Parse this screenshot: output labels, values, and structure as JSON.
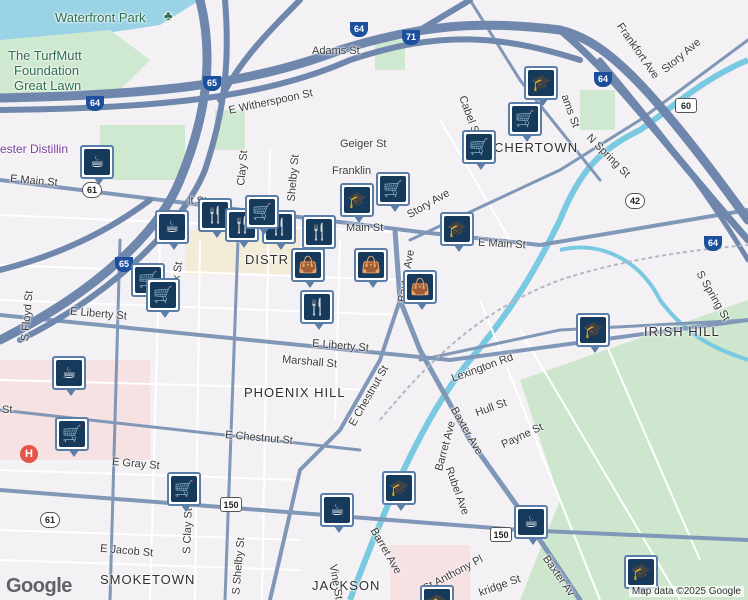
{
  "streets": {
    "e_main_w": "E Main St",
    "e_main_e": "E Main St",
    "main_st_mid": "Main St",
    "e_liberty_w": "E Liberty St",
    "e_liberty_e": "E Liberty St",
    "marshall": "Marshall St",
    "e_chestnut_w": "E Chestnut St",
    "e_chestnut_diag": "E Chestnut St",
    "e_gray": "E Gray St",
    "e_jacob": "E Jacob St",
    "s_clay": "S Clay St",
    "s_shelby": "S Shelby St",
    "s_floyd": "S Floyd St",
    "baxter_ave_n": "Baxter Ave",
    "baxter_ave_s": "Baxter Ave",
    "baxter_ave_se": "Baxter Av",
    "barret_ave": "Barret Ave",
    "barret_ave_s": "Barret Ave",
    "lexington": "Lexington Rd",
    "payne": "Payne St",
    "hull": "Hull St",
    "rubel": "Rubel Ave",
    "story_ave_mid": "Story Ave",
    "story_ave_ne": "Story Ave",
    "frankfort": "Frankfort Ave",
    "n_spring": "N Spring St",
    "s_spring": "S Spring St",
    "geiger": "Geiger St",
    "cabel": "Cabel St",
    "adams": "Adams St",
    "e_witherspoon": "E Witherspoon St",
    "clay_st": "Clay St",
    "shelby_n": "Shelby St",
    "franklin": "Franklin",
    "ck_st": "ck St",
    "st_anthony": "St Anthony Pl",
    "breckinridge": "kridge St",
    "vine": "Vine St",
    "lt_st": "lt St",
    "ams_st": "ams St",
    "st_left": "St"
  },
  "neighborhoods": {
    "butchertown": "BUTCHERTOWN",
    "irish_hill": "IRISH HILL",
    "phoenix_hill": "PHOENIX HILL",
    "smoketown": "SMOKETOWN",
    "jackson": "JACKSON",
    "district": "DISTR"
  },
  "places": {
    "waterfront_park": "Waterfront Park",
    "turfmutt_line1": "The TurfMutt",
    "turfmutt_line2": "Foundation",
    "turfmutt_line3": "Great Lawn",
    "distillery": "ester Distillin"
  },
  "shields": {
    "i64_top": "64",
    "i71": "71",
    "i64_ne": "64",
    "i65": "65",
    "i64_west": "64",
    "i65_sw": "65",
    "i64_se": "64",
    "us60": "60",
    "ky42": "42",
    "ky61_w": "61",
    "ky61_s": "61",
    "us150_mid": "150",
    "us150_e": "150"
  },
  "markers": [
    {
      "type": "cafe",
      "icon": "☕"
    },
    {
      "type": "cafe",
      "icon": "☕"
    },
    {
      "type": "shopping-cart",
      "icon": "🛒"
    },
    {
      "type": "shopping-cart",
      "icon": "🛒"
    },
    {
      "type": "restaurant",
      "icon": "🍴"
    },
    {
      "type": "restaurant",
      "icon": "🍴"
    },
    {
      "type": "restaurant",
      "icon": "🍴"
    },
    {
      "type": "shopping-cart",
      "icon": "🛒"
    },
    {
      "type": "school",
      "icon": "🎓"
    },
    {
      "type": "restaurant",
      "icon": "🍴"
    },
    {
      "type": "shopping-bag",
      "icon": "👜"
    },
    {
      "type": "shopping-bag",
      "icon": "👜"
    },
    {
      "type": "shopping-bag",
      "icon": "👜"
    },
    {
      "type": "restaurant",
      "icon": "🍴"
    },
    {
      "type": "school",
      "icon": "🎓"
    },
    {
      "type": "shopping-cart",
      "icon": "🛒"
    },
    {
      "type": "school",
      "icon": "🎓"
    },
    {
      "type": "shopping-cart",
      "icon": "🛒"
    },
    {
      "type": "school",
      "icon": "🎓"
    },
    {
      "type": "cafe",
      "icon": "☕"
    },
    {
      "type": "shopping-cart",
      "icon": "🛒"
    },
    {
      "type": "shopping-cart",
      "icon": "🛒"
    },
    {
      "type": "cafe",
      "icon": "☕"
    },
    {
      "type": "school",
      "icon": "🎓"
    },
    {
      "type": "cafe",
      "icon": "☕"
    },
    {
      "type": "school",
      "icon": "🎓"
    },
    {
      "type": "school",
      "icon": "🎓"
    },
    {
      "type": "shopping-cart",
      "icon": "🛒"
    }
  ],
  "hospital_symbol": "H",
  "attribution": "Map data ©2025 Google",
  "logo": "Google",
  "colors": {
    "background": "#f3f1f4",
    "road": "#8197b8",
    "highway": "#6f87ad",
    "park": "#cde9cf",
    "water": "#79c9e0",
    "marker_fill": "#163a5c",
    "marker_border": "#5a7ea8"
  }
}
